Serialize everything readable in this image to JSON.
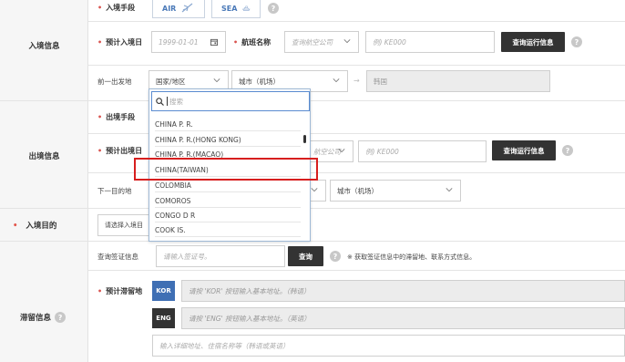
{
  "sections": {
    "entry_info": "入境信息",
    "exit_info": "出境信息",
    "entry_purpose": "入境目的",
    "stay_info": "滞留信息"
  },
  "rows": {
    "entry_method": {
      "label": "入境手段",
      "air": "AIR",
      "sea": "SEA"
    },
    "entry_date": {
      "label": "预计入境日",
      "placeholder": "1999-01-01",
      "airline_label": "航班名称",
      "airline_placeholder": "查询航空公司",
      "flight_placeholder": "例) KE000",
      "query_btn": "查询运行信息"
    },
    "prev_origin": {
      "label": "前一出发地",
      "country_value": "国家/地区",
      "city_value": "城市（机场）",
      "result_value": "韩国"
    },
    "exit_method": {
      "label": "出境手段"
    },
    "exit_date": {
      "label": "预计出境日",
      "airline_placeholder": "航空公司",
      "flight_placeholder": "例) KE000",
      "query_btn": "查询运行信息"
    },
    "next_dest": {
      "label": "下一目的地",
      "city_value": "城市（机场）"
    },
    "purpose": {
      "select_value": "请选择入境目"
    },
    "visa": {
      "label": "查询签证信息",
      "placeholder": "请输入签证号。",
      "btn": "查询",
      "note": "※ 获取签证信息中的滞留地、联系方式信息。"
    },
    "stay_place": {
      "label": "预计滞留地",
      "kor_tag": "KOR",
      "kor_placeholder": "请按 'KOR' 按钮输入基本地址。（韩语）",
      "eng_tag": "ENG",
      "eng_placeholder": "请按 'ENG' 按钮输入基本地址。（英语）",
      "detail_placeholder": "输入详细地址、住宿名称等（韩语或英语）"
    }
  },
  "dropdown": {
    "search_placeholder": "搜索",
    "items": [
      "CHINA P. R.",
      "CHINA P. R.(HONG KONG)",
      "CHINA P. R.(MACAO)",
      "CHINA(TAIWAN)",
      "COLOMBIA",
      "COMOROS",
      "CONGO D R",
      "COOK IS."
    ],
    "highlighted": "CHINA(TAIWAN)"
  },
  "colors": {
    "required_dot": "#d9534f",
    "highlight_border": "#d71e1e",
    "kor_tag": "#3f6fb4",
    "eng_tag": "#333333",
    "mode_text": "#4a79b8"
  }
}
